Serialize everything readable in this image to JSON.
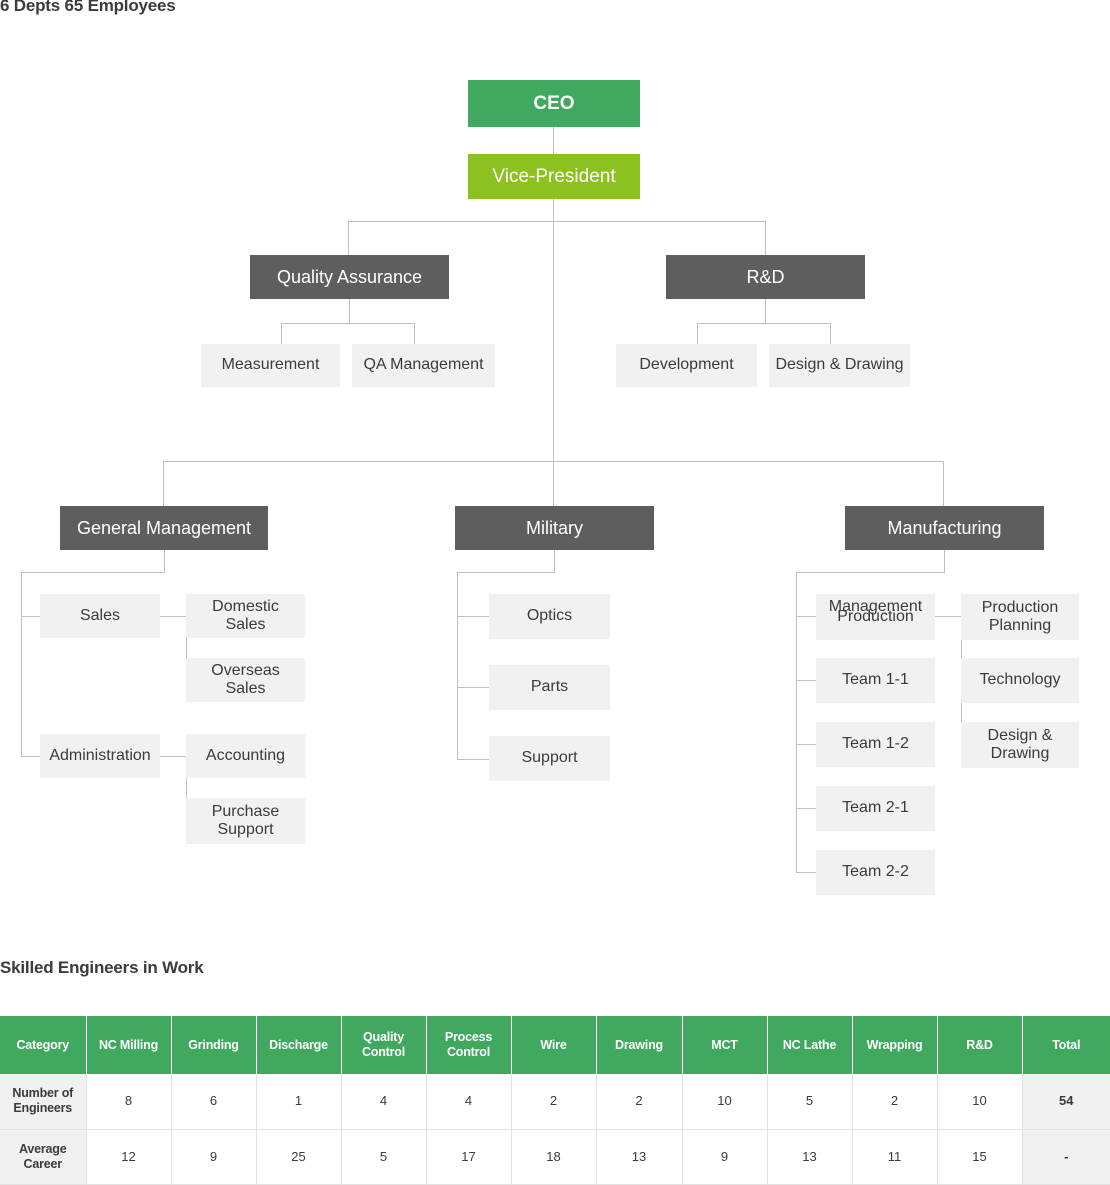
{
  "header": {
    "title": "6 Depts 65 Employees"
  },
  "org_chart": {
    "ceo": "CEO",
    "vice_president": "Vice-President",
    "quality_assurance": {
      "label": "Quality Assurance",
      "children": [
        "Measurement",
        "QA Management"
      ]
    },
    "rnd": {
      "label": "R&D",
      "children": [
        "Development",
        "Design & Drawing"
      ]
    },
    "general_management": {
      "label": "General Management",
      "children": [
        {
          "label": "Sales",
          "children": [
            "Domestic Sales",
            "Overseas Sales"
          ]
        },
        {
          "label": "Administration",
          "children": [
            "Accounting",
            "Purchase Support"
          ]
        }
      ]
    },
    "military": {
      "label": "Military",
      "children": [
        "Optics",
        "Parts",
        "Support"
      ]
    },
    "manufacturing": {
      "label": "Manufacturing",
      "children": [
        {
          "label": "Production",
          "overlap_label": "Management"
        },
        {
          "label": "Team 1-1"
        },
        {
          "label": "Team 1-2"
        },
        {
          "label": "Team 2-1"
        },
        {
          "label": "Team 2-2"
        }
      ],
      "grandchildren": [
        "Production Planning",
        "Technology",
        "Design & Drawing"
      ]
    }
  },
  "engineers_section": {
    "title": "Skilled Engineers in Work",
    "table": {
      "columns": [
        "Category",
        "NC Milling",
        "Grinding",
        "Discharge",
        "Quality Control",
        "Process Control",
        "Wire",
        "Drawing",
        "MCT",
        "NC Lathe",
        "Wrapping",
        "R&D",
        "Total"
      ],
      "rows": [
        {
          "label": "Number of Engineers",
          "values": [
            "8",
            "6",
            "1",
            "4",
            "4",
            "2",
            "2",
            "10",
            "5",
            "2",
            "10"
          ],
          "total": "54"
        },
        {
          "label": "Average Career",
          "values": [
            "12",
            "9",
            "25",
            "5",
            "17",
            "18",
            "13",
            "9",
            "13",
            "11",
            "15"
          ],
          "total": "-"
        }
      ]
    }
  },
  "colors": {
    "ceo_green": "#41a85f",
    "vp_lime": "#8cc220",
    "dept_gray": "#5e5e5e",
    "sub_gray": "#f1f1f1",
    "line_gray": "#bfbfbf",
    "table_header_green": "#41a85f"
  }
}
